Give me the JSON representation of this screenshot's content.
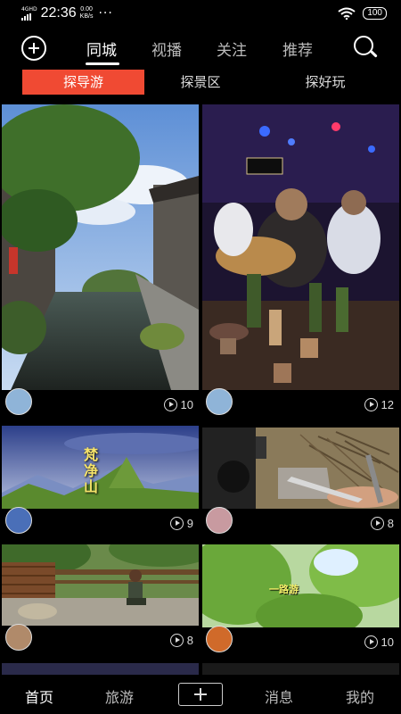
{
  "status_bar": {
    "network": "4GHD",
    "time": "22:36",
    "speed_value": "0.00",
    "speed_unit": "KB/s",
    "more": "···",
    "battery": "100"
  },
  "top_nav": {
    "tabs": [
      {
        "label": "同城",
        "active": true
      },
      {
        "label": "视播",
        "active": false
      },
      {
        "label": "关注",
        "active": false
      },
      {
        "label": "推荐",
        "active": false
      }
    ],
    "plus_icon": "plus-circle-icon",
    "search_icon": "search-icon"
  },
  "sub_tabs": [
    {
      "label": "探导游",
      "active": true
    },
    {
      "label": "探景区",
      "active": false
    },
    {
      "label": "探好玩",
      "active": false
    }
  ],
  "accent_color": "#f04a33",
  "videos": [
    {
      "views": "10",
      "overlay_text": ""
    },
    {
      "views": "12",
      "overlay_text": ""
    },
    {
      "views": "9",
      "overlay_text": "梵净山"
    },
    {
      "views": "8",
      "overlay_text": ""
    },
    {
      "views": "8",
      "overlay_text": ""
    },
    {
      "views": "10",
      "overlay_text": "一路游"
    }
  ],
  "bottom_nav": {
    "items": [
      {
        "label": "首页",
        "active": true
      },
      {
        "label": "旅游",
        "active": false
      },
      {
        "label": "消息",
        "active": false
      },
      {
        "label": "我的",
        "active": false
      }
    ],
    "add_icon": "plus-icon"
  }
}
